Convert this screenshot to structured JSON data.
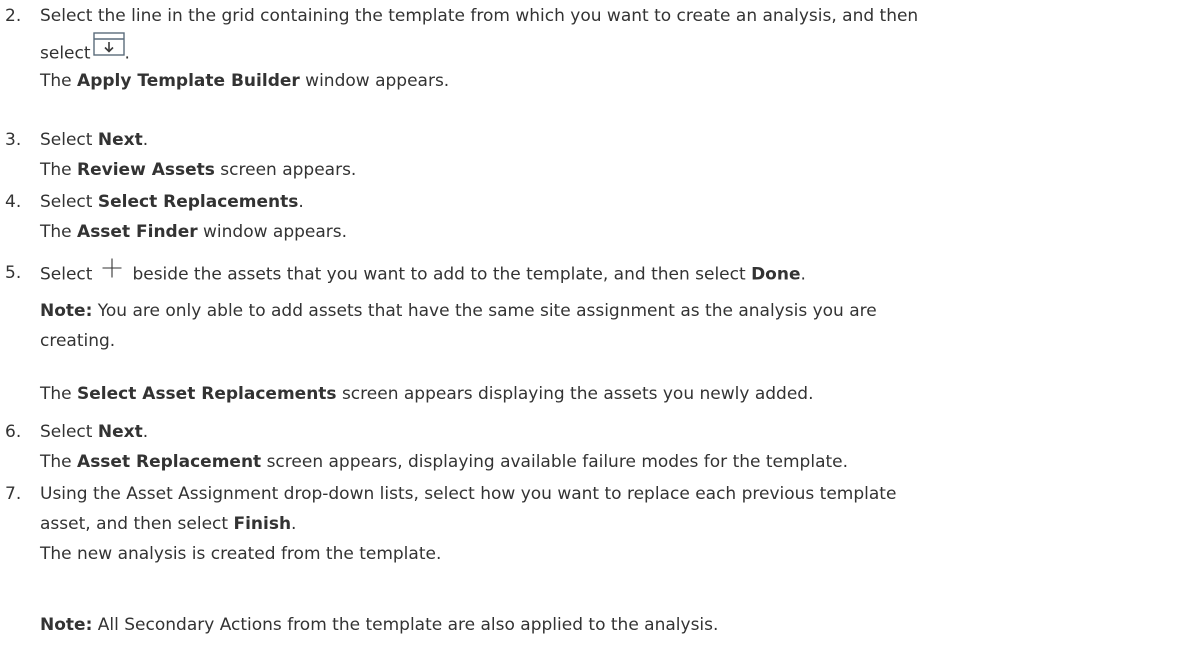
{
  "steps": [
    {
      "number": "2.",
      "line1": "Select the line in the grid containing the template from which you want to create an analysis, and then",
      "line2_pre": "select",
      "line2_post": ".",
      "icon": "export-to-grid-icon",
      "result_pre": "The ",
      "result_bold": "Apply Template Builder",
      "result_post": " window appears."
    },
    {
      "number": "3.",
      "pre": "Select ",
      "bold": "Next",
      "post": ".",
      "result_pre": "The ",
      "result_bold": "Review Assets",
      "result_post": " screen appears."
    },
    {
      "number": "4.",
      "pre": "Select ",
      "bold": "Select Replacements",
      "post": ".",
      "result_pre": "The ",
      "result_bold": "Asset Finder",
      "result_post": " window appears."
    },
    {
      "number": "5.",
      "pre": "Select",
      "icon": "plus-icon",
      "mid": "beside the assets that you want to add to the template, and then select ",
      "bold": "Done",
      "post": ".",
      "note_label": "Note:",
      "note_line1": " You are only able to add assets that have the same site assignment as the analysis you are",
      "note_line2": "creating.",
      "result_pre": "The ",
      "result_bold": "Select Asset Replacements",
      "result_post": " screen appears displaying the assets you newly added."
    },
    {
      "number": "6.",
      "pre": "Select ",
      "bold": "Next",
      "post": ".",
      "result_pre": "The ",
      "result_bold": "Asset Replacement",
      "result_post": " screen appears, displaying available failure modes for the template."
    },
    {
      "number": "7.",
      "line1": "Using the Asset Assignment drop-down lists, select how you want to replace each previous template",
      "line2_pre": "asset, and then select ",
      "bold": "Finish",
      "line2_post": ".",
      "result": "The new analysis is created from the template.",
      "note_label": "Note:",
      "note_text": " All Secondary Actions from the template are also applied to the analysis."
    }
  ]
}
